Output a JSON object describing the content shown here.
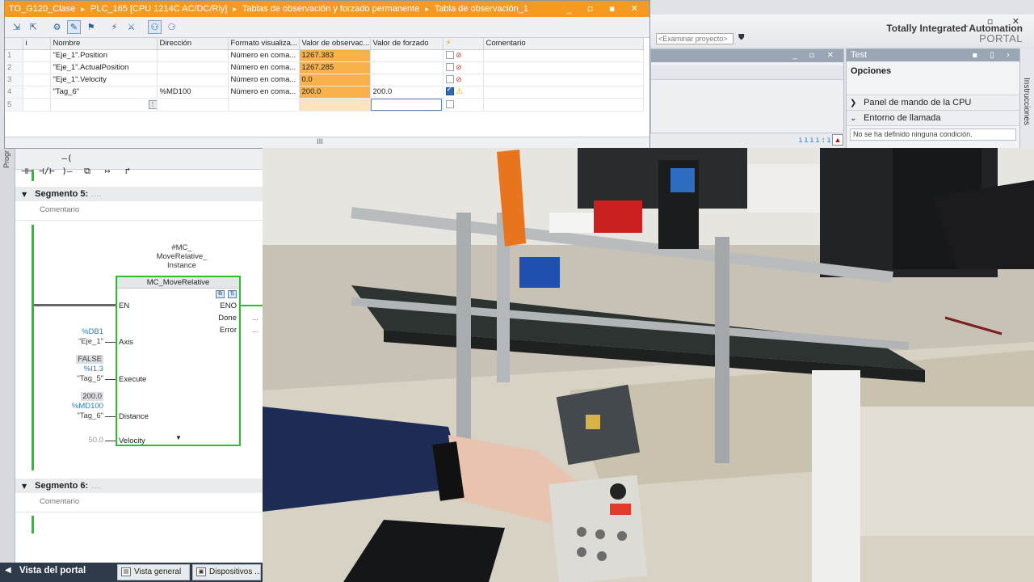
{
  "watch_window": {
    "breadcrumb": [
      "TO_G120_Clase",
      "PLC_165 [CPU 1214C AC/DC/Rly]",
      "Tablas de observación y forzado permanente",
      "Tabla de observación_1"
    ],
    "separator": "▸",
    "window_controls": "_ ▫ ▪ ✕",
    "columns": [
      "i",
      "Nombre",
      "Dirección",
      "Formato visualiza...",
      "Valor de observac...",
      "Valor de forzado",
      "",
      "Comentario"
    ],
    "rows": [
      {
        "num": "1",
        "name": "\"Eje_1\".Position",
        "address": "",
        "format": "Número en coma...",
        "monitor": "1267.383",
        "force": "",
        "force_checked": false,
        "icon": "force"
      },
      {
        "num": "2",
        "name": "\"Eje_1\".ActualPosition",
        "address": "",
        "format": "Número en coma...",
        "monitor": "1267.285",
        "force": "",
        "force_checked": false,
        "icon": "force"
      },
      {
        "num": "3",
        "name": "\"Eje_1\".Velocity",
        "address": "",
        "format": "Número en coma...",
        "monitor": "0.0",
        "force": "",
        "force_checked": false,
        "icon": "force"
      },
      {
        "num": "4",
        "name": "\"Tag_6\"",
        "address": "%MD100",
        "format": "Número en coma...",
        "monitor": "200.0",
        "force": "200.0",
        "force_checked": true,
        "icon": "warning"
      },
      {
        "num": "5",
        "name": "",
        "address": "",
        "format": "",
        "monitor": "",
        "force": "",
        "force_checked": false,
        "icon": ""
      }
    ],
    "scroll_grip": "III"
  },
  "tia": {
    "brand_line1": "Totally Integrated Automation",
    "brand_line2": "PORTAL",
    "window_controls": "_ ▫ ✕",
    "browse_placeholder": "<Examinar proyecto>",
    "task_panel_title": "Test",
    "options_label": "Opciones",
    "sections": [
      {
        "chevron": "❯",
        "label": "Panel de mando de la CPU"
      },
      {
        "chevron": "⌄",
        "label": "Entorno de llamada"
      }
    ],
    "condition_text": "No se ha definido ninguna condición.",
    "side_tab": "Instrucciones",
    "status_dots": "ıııı:ııı"
  },
  "program": {
    "side_tab": "Progr",
    "toolbar": [
      "⊣⊢",
      "⊣/⊢",
      "–( )–",
      "⧉",
      "↦",
      "↱"
    ],
    "segment5": {
      "label": "Segmento 5:",
      "dots": "....",
      "comment": "Comentario"
    },
    "segment6": {
      "label": "Segmento 6:",
      "dots": "....",
      "comment": "Comentario"
    },
    "instance": [
      "#MC_",
      "MoveRelative_",
      "Instance"
    ],
    "block_name": "MC_MoveRelative",
    "pins_in": [
      "EN",
      "Axis",
      "Execute",
      "Distance",
      "Velocity"
    ],
    "pins_out": [
      "ENO",
      "Done",
      "Error"
    ],
    "out_dots": "...",
    "params": {
      "axis_addr": "%DB1",
      "axis_tag": "\"Eje_1\"",
      "execute_value": "FALSE",
      "execute_addr": "%I1.3",
      "execute_tag": "\"Tag_5\"",
      "distance_value": "200.0",
      "distance_addr": "%MD100",
      "distance_tag": "\"Tag_6\"",
      "velocity_value": "50.0"
    }
  },
  "taskbar": {
    "portal_view": "Vista del portal",
    "tabs": [
      "Vista general",
      "Dispositivos ..."
    ]
  },
  "colors": {
    "title_orange": "#f59a1e",
    "monitor_value": "#f9b24b",
    "rung_green": "#2dbe2d",
    "address_blue": "#2b7fb8"
  }
}
